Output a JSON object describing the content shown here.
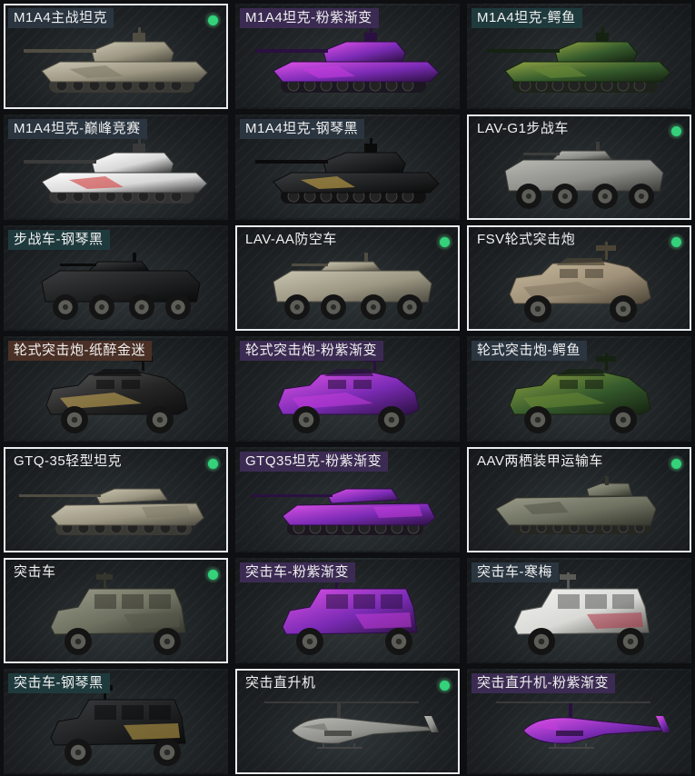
{
  "colors": {
    "owned_badge": "#34d27a",
    "owned_border": "#e9ecef",
    "label_slate": "#2a3540",
    "label_purple": "#3b2b52",
    "label_teal": "#1f3a3d",
    "label_brown": "#4a3026"
  },
  "vehicles": [
    {
      "name": "M1A4主战坦克",
      "type": "tank",
      "skin": "desert",
      "label_color": "slate",
      "owned": true
    },
    {
      "name": "M1A4坦克-粉紫渐变",
      "type": "tank",
      "skin": "purple",
      "label_color": "purple",
      "owned": false
    },
    {
      "name": "M1A4坦克-鳄鱼",
      "type": "tank",
      "skin": "croc",
      "label_color": "teal",
      "owned": false
    },
    {
      "name": "M1A4坦克-巅峰竞赛",
      "type": "tank",
      "skin": "red",
      "label_color": "slate",
      "owned": false
    },
    {
      "name": "M1A4坦克-钢琴黑",
      "type": "tank",
      "skin": "black",
      "label_color": "slate",
      "owned": false
    },
    {
      "name": "LAV-G1步战车",
      "type": "ifv",
      "skin": "grey",
      "label_color": "none",
      "owned": true
    },
    {
      "name": "步战车-钢琴黑",
      "type": "ifv",
      "skin": "black",
      "label_color": "teal",
      "owned": false
    },
    {
      "name": "LAV-AA防空车",
      "type": "ifv",
      "skin": "desert",
      "label_color": "none",
      "owned": true
    },
    {
      "name": "FSV轮式突击炮",
      "type": "armored_car",
      "skin": "tan",
      "label_color": "none",
      "owned": true
    },
    {
      "name": "轮式突击炮-纸醉金迷",
      "type": "armored_car",
      "skin": "blackgold",
      "label_color": "brown",
      "owned": false
    },
    {
      "name": "轮式突击炮-粉紫渐变",
      "type": "armored_car",
      "skin": "purple",
      "label_color": "purple",
      "owned": false
    },
    {
      "name": "轮式突击炮-鳄鱼",
      "type": "armored_car",
      "skin": "croc",
      "label_color": "slate",
      "owned": false
    },
    {
      "name": "GTQ-35轻型坦克",
      "type": "light_tank",
      "skin": "desert",
      "label_color": "none",
      "owned": true
    },
    {
      "name": "GTQ35坦克-粉紫渐变",
      "type": "light_tank",
      "skin": "purple",
      "label_color": "purple",
      "owned": false
    },
    {
      "name": "AAV两栖装甲运输车",
      "type": "amphibious",
      "skin": "olive",
      "label_color": "none",
      "owned": true
    },
    {
      "name": "突击车",
      "type": "mrap",
      "skin": "olive",
      "label_color": "none",
      "owned": true
    },
    {
      "name": "突击车-粉紫渐变",
      "type": "mrap",
      "skin": "purple",
      "label_color": "purple",
      "owned": false
    },
    {
      "name": "突击车-寒梅",
      "type": "mrap",
      "skin": "white",
      "label_color": "slate",
      "owned": false
    },
    {
      "name": "突击车-钢琴黑",
      "type": "mrap",
      "skin": "black",
      "label_color": "teal",
      "owned": false
    },
    {
      "name": "突击直升机",
      "type": "helicopter",
      "skin": "grey",
      "label_color": "none",
      "owned": true
    },
    {
      "name": "突击直升机-粉紫渐变",
      "type": "helicopter",
      "skin": "purple",
      "label_color": "purple",
      "owned": false
    }
  ]
}
